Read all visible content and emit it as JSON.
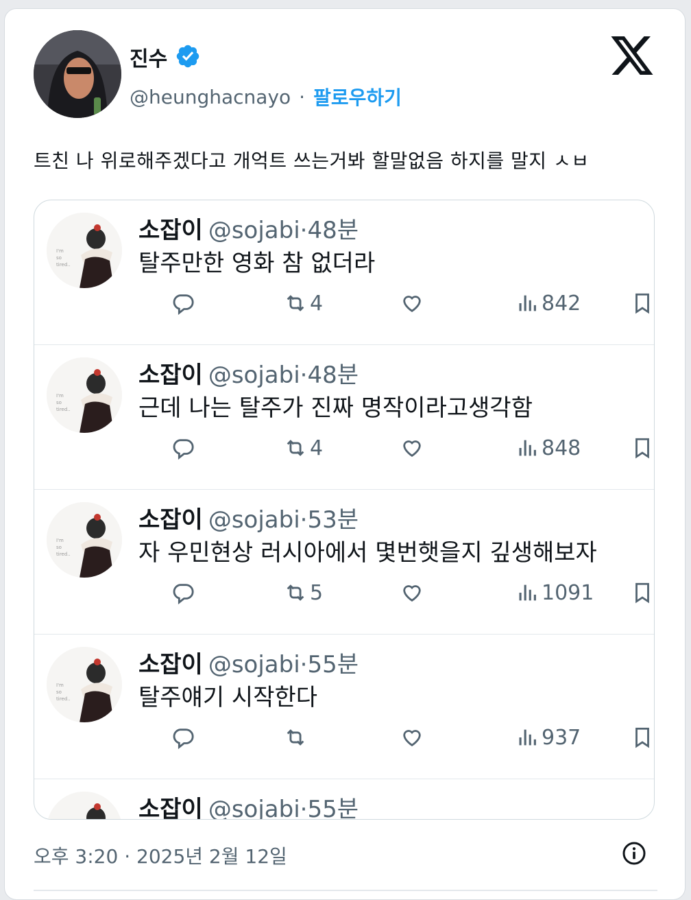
{
  "author": {
    "name": "진수",
    "handle": "@heunghacnayo",
    "separator": "·",
    "follow_label": "팔로우하기"
  },
  "tweet": {
    "text": "트친 나 위로해주겠다고 개억트 쓰는거봐 할말없음 하지를 말지 ㅅㅂ"
  },
  "replies": [
    {
      "name": "소잡이",
      "handle": "@sojabi",
      "time": "·48분",
      "text": "탈주만한 영화 참 없더라",
      "retweets": "4",
      "views": "842"
    },
    {
      "name": "소잡이",
      "handle": "@sojabi",
      "time": "·48분",
      "text": "근데 나는 탈주가 진짜 명작이라고생각함",
      "retweets": "4",
      "views": "848"
    },
    {
      "name": "소잡이",
      "handle": "@sojabi",
      "time": "·53분",
      "text": "자  우민현상 러시아에서 몇번햇을지 깊생해보자",
      "retweets": "5",
      "views": "1091"
    },
    {
      "name": "소잡이",
      "handle": "@sojabi",
      "time": "·55분",
      "text": "탈주얘기 시작한다",
      "retweets": "",
      "views": "937"
    },
    {
      "name": "소잡이",
      "handle": "@sojabi",
      "time": "·55분",
      "text": "",
      "retweets": "",
      "views": ""
    }
  ],
  "footer": {
    "timestamp": "오후 3:20 · 2025년 2월 12일"
  },
  "colors": {
    "accent": "#1d9bf0",
    "muted": "#536471",
    "text": "#0f1419"
  },
  "icons": [
    "verified-badge-icon",
    "x-logo-icon",
    "reply-icon",
    "retweet-icon",
    "like-icon",
    "views-icon",
    "bookmark-icon",
    "info-icon"
  ]
}
